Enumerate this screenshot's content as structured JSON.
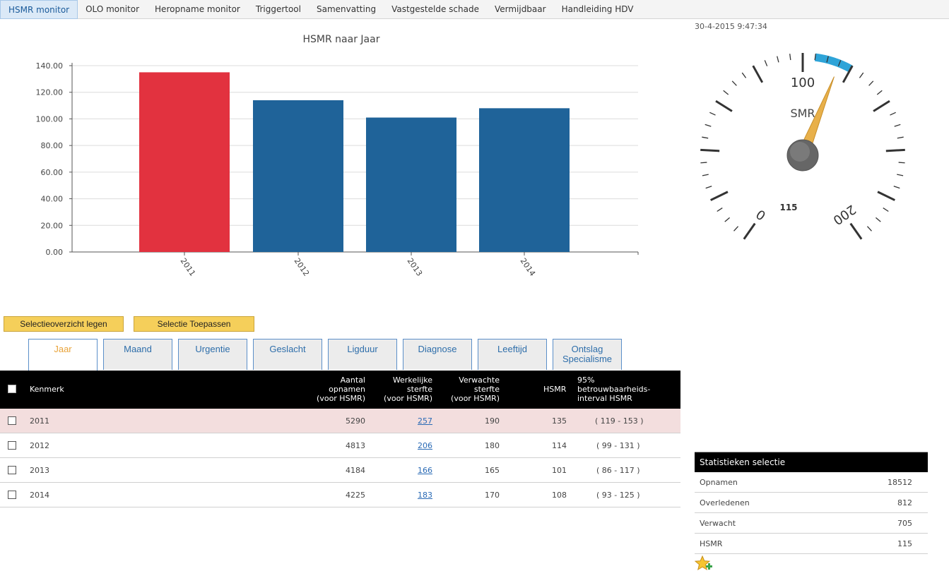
{
  "nav": {
    "items": [
      "HSMR monitor",
      "OLO monitor",
      "Heropname monitor",
      "Triggertool",
      "Samenvatting",
      "Vastgestelde schade",
      "Vermijdbaar",
      "Handleiding HDV"
    ],
    "active": 0
  },
  "timestamp": "30-4-2015 9:47:34",
  "chart_data": {
    "type": "bar",
    "title": "HSMR naar Jaar",
    "categories": [
      "2011",
      "2012",
      "2013",
      "2014"
    ],
    "values": [
      135,
      114,
      101,
      108
    ],
    "colors": [
      "#e2323f",
      "#1f6399",
      "#1f6399",
      "#1f6399"
    ],
    "ylim": [
      0,
      140
    ],
    "yticks": [
      "0.00",
      "20.00",
      "40.00",
      "60.00",
      "80.00",
      "100.00",
      "120.00",
      "140.00"
    ],
    "grid": true,
    "xlabel": "",
    "ylabel": ""
  },
  "gauge": {
    "label": "SMR",
    "value": 115,
    "value_text": "115",
    "min": 0,
    "max": 200,
    "scale_labels": [
      "0",
      "100",
      "200"
    ],
    "band_from": 105,
    "band_to": 120,
    "band_color": "#2ea4d8",
    "needle_color": "#e8b04a"
  },
  "buttons": {
    "clear": "Selectieoverzicht legen",
    "apply": "Selectie Toepassen"
  },
  "tabs": [
    {
      "label": "Jaar",
      "active": true
    },
    {
      "label": "Maand"
    },
    {
      "label": "Urgentie"
    },
    {
      "label": "Geslacht"
    },
    {
      "label": "Ligduur"
    },
    {
      "label": "Diagnose"
    },
    {
      "label": "Leeftijd"
    },
    {
      "label": "Ontslag Specialisme"
    }
  ],
  "table": {
    "headers": {
      "kenmerk": "Kenmerk",
      "opnamen": [
        "Aantal",
        "opnamen",
        "(voor HSMR)"
      ],
      "werkelijk": [
        "Werkelijke",
        "sterfte",
        "(voor HSMR)"
      ],
      "verwacht": [
        "Verwachte",
        "sterfte",
        "(voor HSMR)"
      ],
      "hsmr": "HSMR",
      "interval": [
        "95%",
        "betrouwbaarheids-",
        "interval HSMR"
      ]
    },
    "rows": [
      {
        "kenmerk": "2011",
        "opnamen": "5290",
        "werkelijk": "257",
        "verwacht": "190",
        "hsmr": "135",
        "interval": "( 119 - 153 )",
        "selected": true
      },
      {
        "kenmerk": "2012",
        "opnamen": "4813",
        "werkelijk": "206",
        "verwacht": "180",
        "hsmr": "114",
        "interval": "( 99 - 131 )"
      },
      {
        "kenmerk": "2013",
        "opnamen": "4184",
        "werkelijk": "166",
        "verwacht": "165",
        "hsmr": "101",
        "interval": "( 86 - 117 )"
      },
      {
        "kenmerk": "2014",
        "opnamen": "4225",
        "werkelijk": "183",
        "verwacht": "170",
        "hsmr": "108",
        "interval": "( 93 - 125 )"
      }
    ]
  },
  "stats": {
    "title": "Statistieken selectie",
    "rows": [
      {
        "label": "Opnamen",
        "value": "18512"
      },
      {
        "label": "Overledenen",
        "value": "812"
      },
      {
        "label": "Verwacht",
        "value": "705"
      },
      {
        "label": "HSMR",
        "value": "115"
      }
    ]
  },
  "icons": {
    "favorite": "star-add-icon"
  }
}
